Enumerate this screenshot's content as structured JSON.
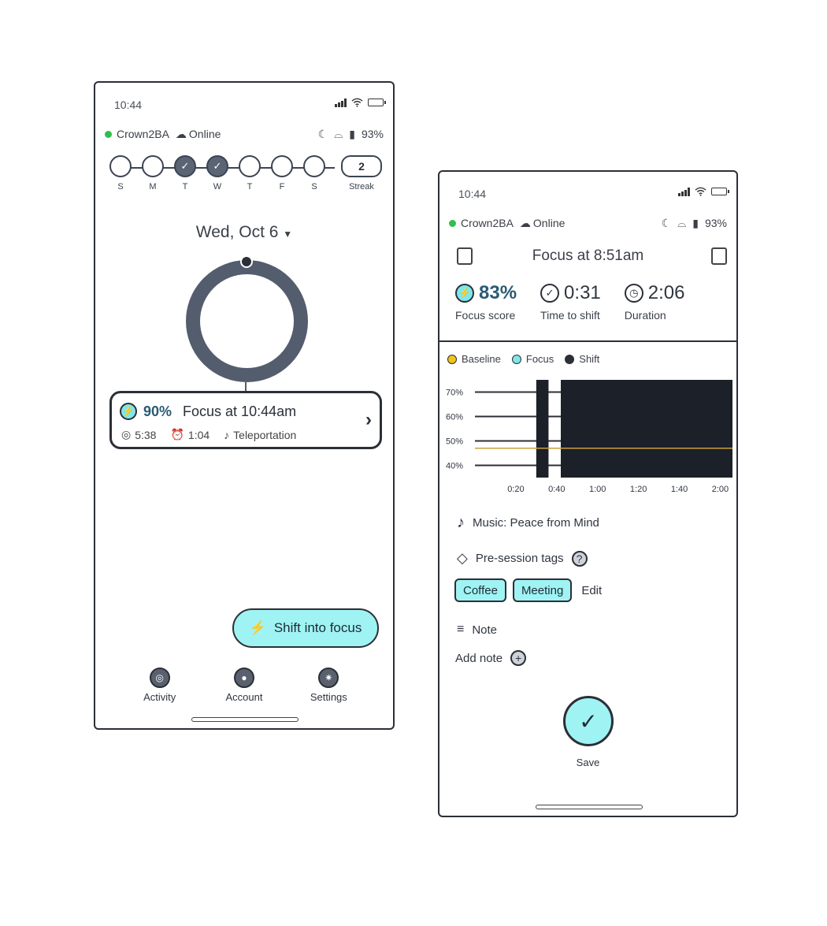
{
  "phone_home": {
    "status": {
      "time": "10:44"
    },
    "device": {
      "name": "Crown2BA",
      "status": "Online",
      "battery": "93%"
    },
    "week": {
      "days": [
        {
          "label": "S",
          "done": false
        },
        {
          "label": "M",
          "done": false
        },
        {
          "label": "T",
          "done": true
        },
        {
          "label": "W",
          "done": true
        },
        {
          "label": "T",
          "done": false
        },
        {
          "label": "F",
          "done": false
        },
        {
          "label": "S",
          "done": false
        }
      ],
      "streak_value": "2",
      "streak_label": "Streak"
    },
    "date": "Wed, Oct 6",
    "session": {
      "percent": "90%",
      "title": "Focus at 10:44am",
      "time_to_shift": "5:38",
      "duration": "1:04",
      "music": "Teleportation"
    },
    "fab_label": "Shift into focus",
    "nav": {
      "activity": "Activity",
      "account": "Account",
      "settings": "Settings"
    }
  },
  "phone_detail": {
    "status": {
      "time": "10:44"
    },
    "device": {
      "name": "Crown2BA",
      "status": "Online",
      "battery": "93%"
    },
    "title": "Focus at 8:51am",
    "stats": {
      "focus_score": {
        "value": "83%",
        "label": "Focus score"
      },
      "time_to_shift": {
        "value": "0:31",
        "label": "Time to shift"
      },
      "duration": {
        "value": "2:06",
        "label": "Duration"
      }
    },
    "legend": {
      "baseline": "Baseline",
      "focus": "Focus",
      "shift": "Shift"
    },
    "music": "Music: Peace from Mind",
    "pre_session_tags": "Pre-session tags",
    "tags": [
      "Coffee",
      "Meeting"
    ],
    "edit": "Edit",
    "note": "Note",
    "add_note": "Add note",
    "save": "Save"
  },
  "colors": {
    "accent": "#9ff3f3",
    "dark": "#2b2f36",
    "ring": "#535d6d",
    "baseline": "#f0c419",
    "focus": "#7fe7ea"
  },
  "chart_data": {
    "type": "bar",
    "x_ticks": [
      "0:20",
      "0:40",
      "1:00",
      "1:20",
      "1:40",
      "2:00"
    ],
    "y_ticks": [
      "70%",
      "60%",
      "50%",
      "40%"
    ],
    "ylim": [
      35,
      75
    ],
    "xlim": [
      0,
      2.1
    ],
    "series": [
      {
        "name": "Shift",
        "segments": [
          {
            "start": 0.5,
            "end": 0.6,
            "value": 75
          },
          {
            "start": 0.7,
            "end": 2.1,
            "value": 75
          }
        ]
      }
    ],
    "baseline_value": 47
  }
}
